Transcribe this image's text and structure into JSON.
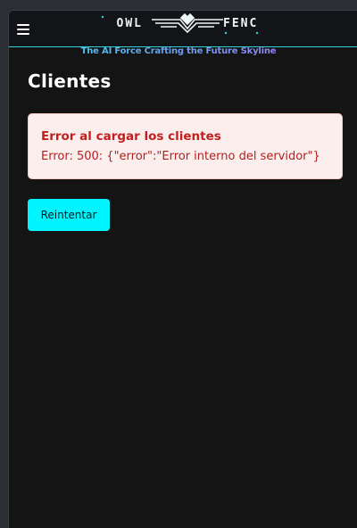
{
  "header": {
    "logo_left": "OWL",
    "logo_right": "FENC",
    "tagline": "The AI Force Crafting the Future Skyline"
  },
  "page": {
    "title": "Clientes"
  },
  "error": {
    "title": "Error al cargar los clientes",
    "message": "Error: 500: {\"error\":\"Error interno del servidor\"}"
  },
  "actions": {
    "retry_label": "Reintentar"
  },
  "colors": {
    "accent": "#00f4ff",
    "background": "#141414",
    "error_text": "#c21f1f",
    "error_bg": "#fdeeee"
  }
}
